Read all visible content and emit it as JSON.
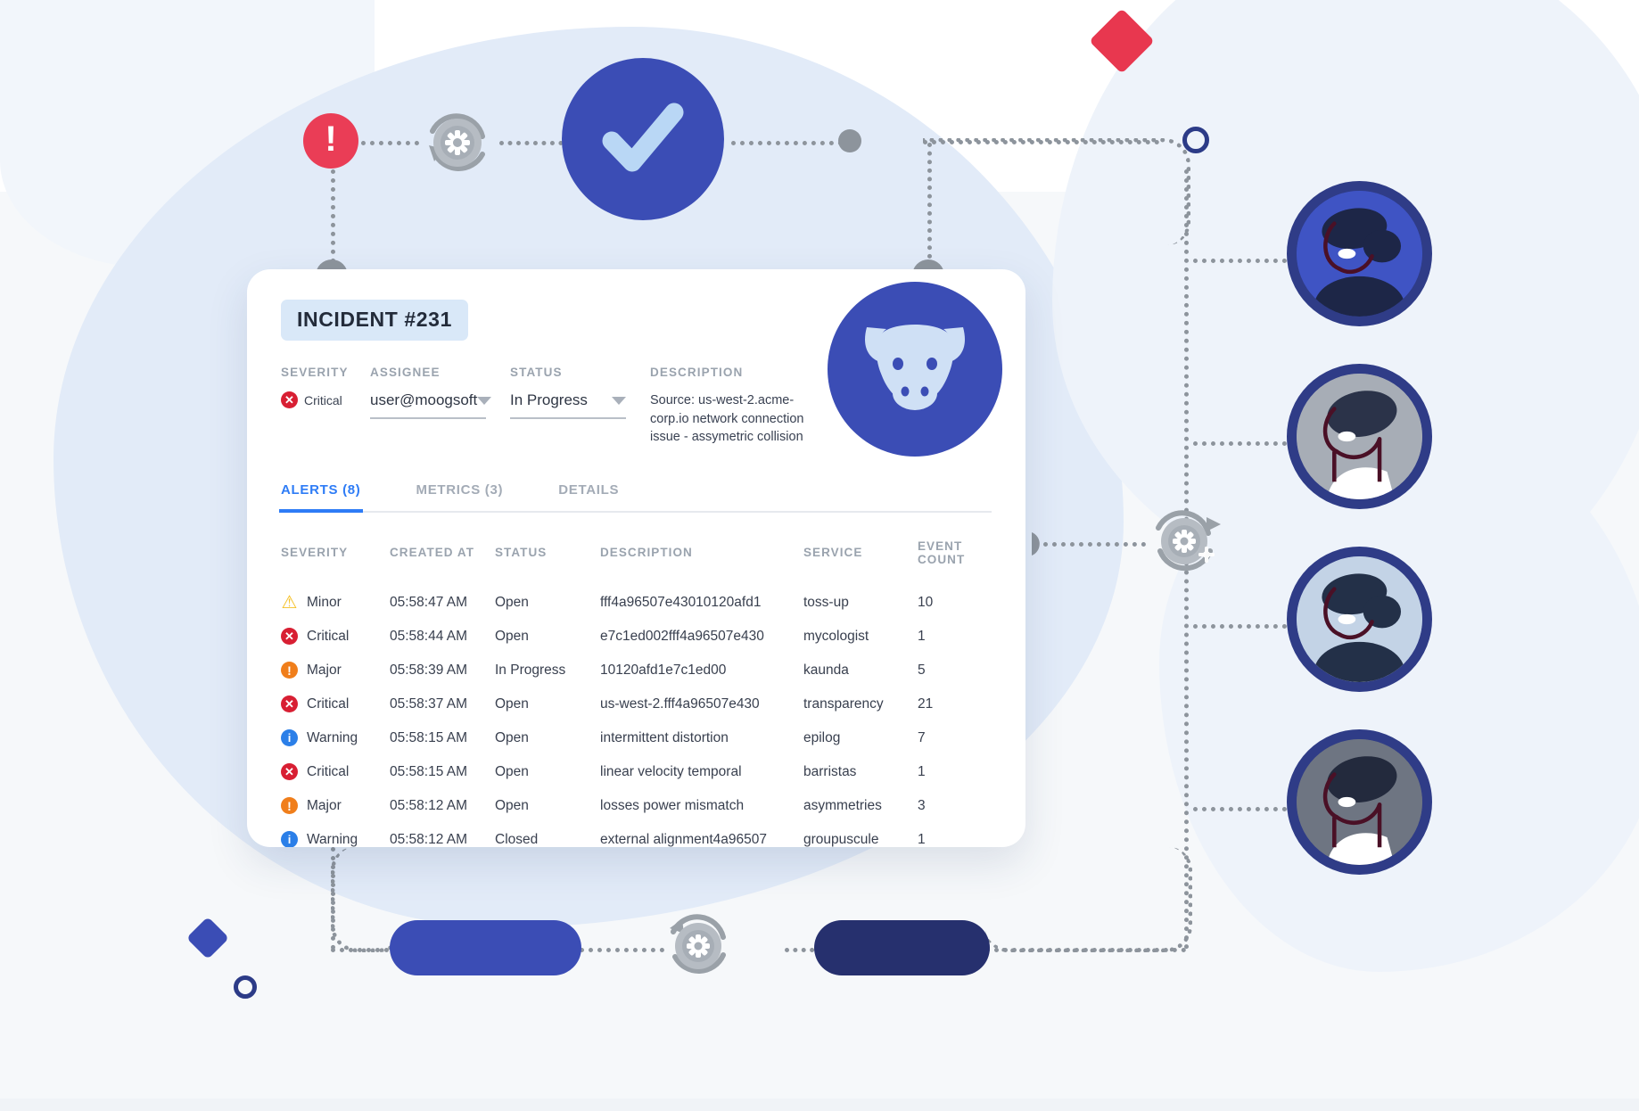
{
  "card": {
    "incident_chip": "INCIDENT #231",
    "meta": {
      "severity_label": "SEVERITY",
      "severity_value": "Critical",
      "assignee_label": "ASSIGNEE",
      "assignee_value": "user@moogsoft",
      "status_label": "STATUS",
      "status_value": "In Progress",
      "description_label": "DESCRIPTION",
      "description_value": "Source: us-west-2.acme-corp.io network connection issue - assymetric collision"
    },
    "tabs": [
      {
        "label": "ALERTS (8)",
        "active": true
      },
      {
        "label": "METRICS (3)",
        "active": false
      },
      {
        "label": "DETAILS",
        "active": false
      }
    ],
    "table": {
      "columns": [
        "SEVERITY",
        "CREATED AT",
        "STATUS",
        "DESCRIPTION",
        "SERVICE",
        "EVENT COUNT"
      ],
      "rows": [
        {
          "severity": "Minor",
          "icon": "warning-triangle-icon",
          "created_at": "05:58:47 AM",
          "status": "Open",
          "description": "fff4a96507e43010120afd1",
          "service": "toss-up",
          "event_count": "10"
        },
        {
          "severity": "Critical",
          "icon": "critical-x-icon",
          "created_at": "05:58:44 AM",
          "status": "Open",
          "description": "e7c1ed002fff4a96507e430",
          "service": "mycologist",
          "event_count": "1"
        },
        {
          "severity": "Major",
          "icon": "major-exclaim-icon",
          "created_at": "05:58:39 AM",
          "status": "In Progress",
          "description": "10120afd1e7c1ed00",
          "service": "kaunda",
          "event_count": "5"
        },
        {
          "severity": "Critical",
          "icon": "critical-x-icon",
          "created_at": "05:58:37 AM",
          "status": "Open",
          "description": "us-west-2.fff4a96507e430",
          "service": "transparency",
          "event_count": "21"
        },
        {
          "severity": "Warning",
          "icon": "warning-info-icon",
          "created_at": "05:58:15 AM",
          "status": "Open",
          "description": "intermittent  distortion",
          "service": "epilog",
          "event_count": "7"
        },
        {
          "severity": "Critical",
          "icon": "critical-x-icon",
          "created_at": "05:58:15 AM",
          "status": "Open",
          "description": "linear velocity temporal",
          "service": "barristas",
          "event_count": "1"
        },
        {
          "severity": "Major",
          "icon": "major-exclaim-icon",
          "created_at": "05:58:12 AM",
          "status": "Open",
          "description": "losses power mismatch",
          "service": "asymmetries",
          "event_count": "3"
        },
        {
          "severity": "Warning",
          "icon": "warning-info-icon",
          "created_at": "05:58:12 AM",
          "status": "Closed",
          "description": "external alignment4a96507",
          "service": "groupuscule",
          "event_count": "1"
        }
      ]
    },
    "logo": "cow-head-icon"
  },
  "decorations": {
    "alert_badge": "alert-exclamation-icon",
    "gear_refresh": "gear-refresh-icon",
    "success_check": "check-circle-icon",
    "hollow_ring": "hollow-ring-icon",
    "red_diamond": "red-diamond-icon",
    "blue_diamond": "blue-diamond-icon",
    "gear_cluster": "gear-cluster-icon",
    "pill_blue": "pill-blue-shape",
    "pill_navy": "pill-navy-shape",
    "avatars": [
      {
        "name": "avatar-agent-1",
        "bg": "#3f54c4",
        "hair": "#1d2647",
        "skin": "#3f54c4"
      },
      {
        "name": "avatar-agent-2",
        "bg": "#a7adb6",
        "hair": "#2b3349",
        "skin": "#a7adb6"
      },
      {
        "name": "avatar-agent-3",
        "bg": "#c3d3e6",
        "hair": "#233048",
        "skin": "#c3d3e6"
      },
      {
        "name": "avatar-agent-4",
        "bg": "#6e7582",
        "hair": "#232a3d",
        "skin": "#6e7582"
      }
    ]
  },
  "colors": {
    "brand_blue": "#3b4db5",
    "accent_blue": "#2e7cf6",
    "critical_red": "#d81f33",
    "major_orange": "#f07e1b",
    "minor_yellow": "#f5c026",
    "warning_blue": "#2b7fe8",
    "badge_red": "#ea3d56",
    "navy": "#26306e",
    "gray_line": "#8d949c"
  }
}
